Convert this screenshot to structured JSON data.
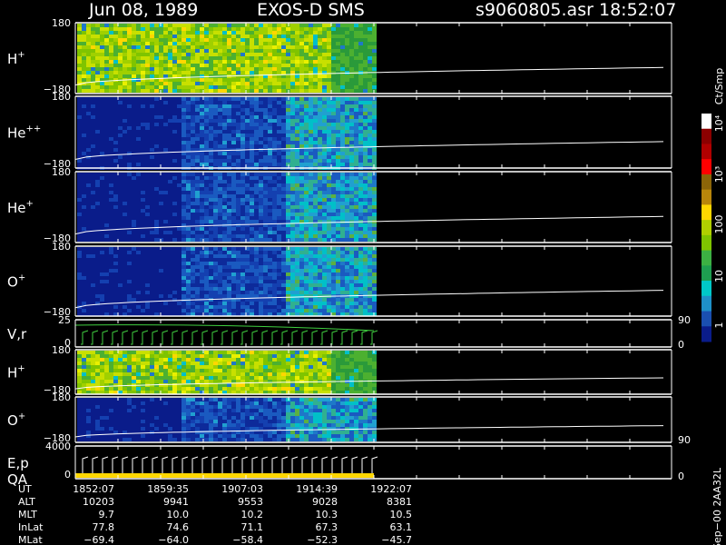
{
  "header": {
    "date": "Jun 08, 1989",
    "instrument": "EXOS-D SMS",
    "file": "s9060805.asr",
    "time": "18:52:07"
  },
  "colorbar": {
    "unit": "Ct/Smp",
    "ticks": [
      "10⁴",
      "10³",
      "100",
      "10",
      "1"
    ],
    "colors": [
      "#ffffff",
      "#8b0000",
      "#b00000",
      "#ff0000",
      "#8b6508",
      "#b8860b",
      "#ffd700",
      "#b0d000",
      "#7fc400",
      "#3cb043",
      "#1e9e50",
      "#00c8c8",
      "#1e90c8",
      "#1a4fb0",
      "#0a1c8a"
    ]
  },
  "panels": [
    {
      "label": "H",
      "sup": "+",
      "ytop": "180",
      "ybot": "−180",
      "noise": 0.2,
      "base": "green"
    },
    {
      "label": "He",
      "sup": "++",
      "ytop": "180",
      "ybot": "−180",
      "noise": 0.1,
      "base": "blue"
    },
    {
      "label": "He",
      "sup": "+",
      "ytop": "180",
      "ybot": "−180",
      "noise": 0.12,
      "base": "blue"
    },
    {
      "label": "O",
      "sup": "+",
      "ytop": "180",
      "ybot": "−180",
      "noise": 0.12,
      "base": "blue"
    },
    {
      "label": "V,r",
      "sup": "",
      "ytop": "25",
      "ybot": "0",
      "right_top": "90",
      "right_bot": "0"
    },
    {
      "label": "H",
      "sup": "+",
      "ytop": "180",
      "ybot": "−180",
      "noise": 0.2,
      "base": "green"
    },
    {
      "label": "O",
      "sup": "+",
      "ytop": "180",
      "ybot": "−180",
      "right_bot": "90",
      "noise": 0.12,
      "base": "blue"
    },
    {
      "label": "E,p",
      "label2": "QA",
      "sup": "",
      "ytop": "4000",
      "ybot": "0",
      "right_bot": "0"
    }
  ],
  "footer": {
    "rows": [
      {
        "name": "UT",
        "values": [
          "1852:07",
          "1859:35",
          "1907:03",
          "1914:39",
          "1922:07"
        ]
      },
      {
        "name": "ALT",
        "values": [
          "10203",
          "9941",
          "9553",
          "9028",
          "8381"
        ]
      },
      {
        "name": "MLT",
        "values": [
          "9.7",
          "10.0",
          "10.2",
          "10.3",
          "10.5"
        ]
      },
      {
        "name": "InLat",
        "values": [
          "77.8",
          "74.6",
          "71.1",
          "67.3",
          "63.1"
        ]
      },
      {
        "name": "MLat",
        "values": [
          "−69.4",
          "−64.0",
          "−58.4",
          "−52.3",
          "−45.7"
        ]
      }
    ],
    "side_label": "Sep−00  2AA32L"
  },
  "chart_data": {
    "type": "heatmap",
    "title": "Jun 08, 1989   EXOS-D SMS",
    "x_ticks_ut": [
      "1852:07",
      "1859:35",
      "1907:03",
      "1914:39",
      "1922:07"
    ],
    "panels": [
      "H+",
      "He++",
      "He+",
      "O+",
      "V,r",
      "H+",
      "O+",
      "E,p QA"
    ],
    "colorbar_unit": "Ct/Smp",
    "colorbar_range": [
      1,
      10000
    ],
    "colorbar_scale": "log"
  }
}
